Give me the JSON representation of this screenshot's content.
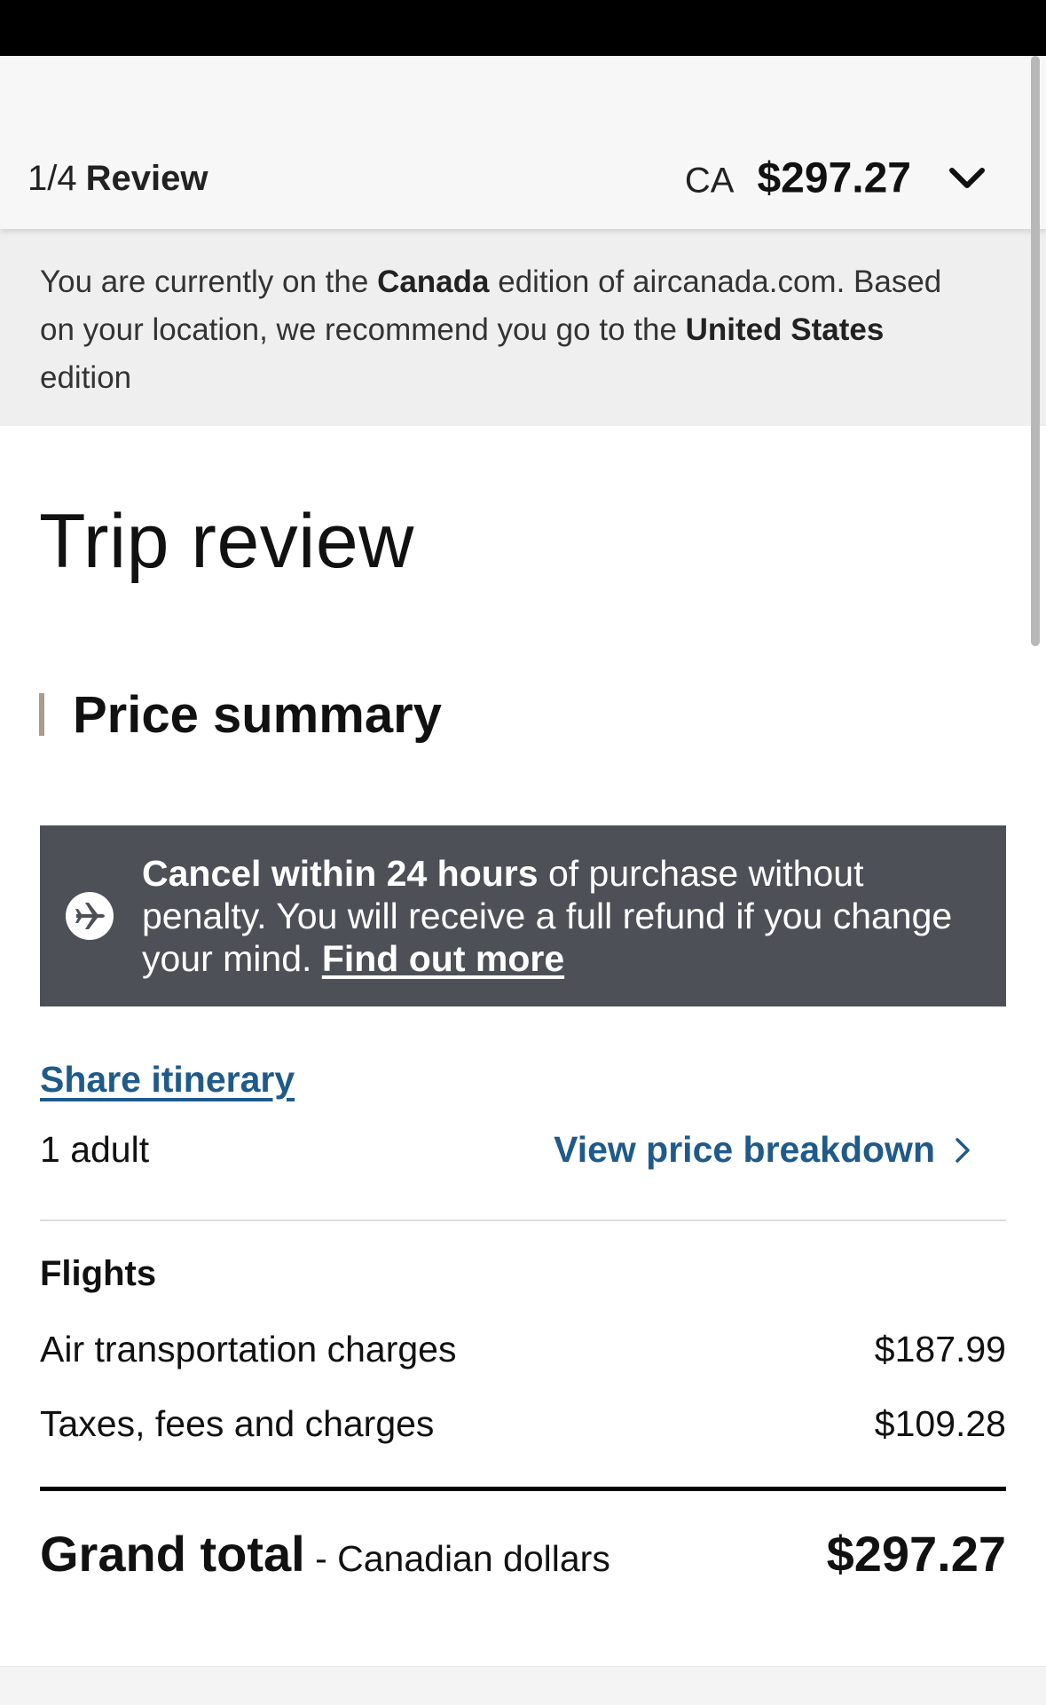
{
  "header": {
    "step_count": "1/4",
    "step_name": "Review",
    "currency": "CA",
    "total": "$297.27",
    "toggle_icon": "chevron-down-icon"
  },
  "edition_notice": {
    "part1": "You are currently on the ",
    "current_edition": "Canada",
    "part2": " edition of aircanada.com. Based on your location, we recommend you go to the ",
    "recommended_edition": "United States",
    "part3": " edition"
  },
  "page": {
    "title": "Trip review"
  },
  "price_summary": {
    "heading": "Price summary",
    "cancel_notice": {
      "icon": "airplane-icon",
      "bold_text": "Cancel within 24 hours",
      "text": " of purchase without penalty. You will receive a full refund if you change your mind. ",
      "link_label": "Find out more"
    },
    "share_label": "Share itinerary",
    "passengers": "1 adult",
    "breakdown_label": "View price breakdown",
    "flights_heading": "Flights",
    "charges": [
      {
        "label": "Air transportation charges",
        "amount": "$187.99"
      },
      {
        "label": "Taxes, fees and charges",
        "amount": "$109.28"
      }
    ],
    "grand_total": {
      "label": "Grand total",
      "currency_note": " - Canadian dollars",
      "amount": "$297.27"
    }
  },
  "colors": {
    "link": "#1f5a8a",
    "banner_bg": "#4d5157",
    "accent_bar": "#a89c8b"
  }
}
